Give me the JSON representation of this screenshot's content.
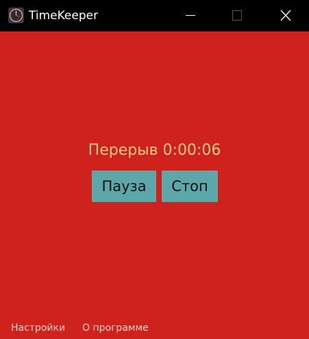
{
  "window": {
    "title": "TimeKeeper",
    "icon": "clock-icon"
  },
  "titlebar_controls": {
    "minimize_icon": "minimize-icon",
    "maximize_icon": "maximize-icon",
    "close_icon": "close-icon"
  },
  "timer": {
    "status_text": "Перерыв 0:00:06"
  },
  "buttons": {
    "pause_label": "Пауза",
    "stop_label": "Стоп"
  },
  "footer": {
    "settings_label": "Настройки",
    "about_label": "О программе"
  },
  "colors": {
    "background": "#cf221d",
    "status_text": "#f5cf86",
    "button_bg": "#5ba7a9",
    "titlebar_bg": "#000000"
  }
}
